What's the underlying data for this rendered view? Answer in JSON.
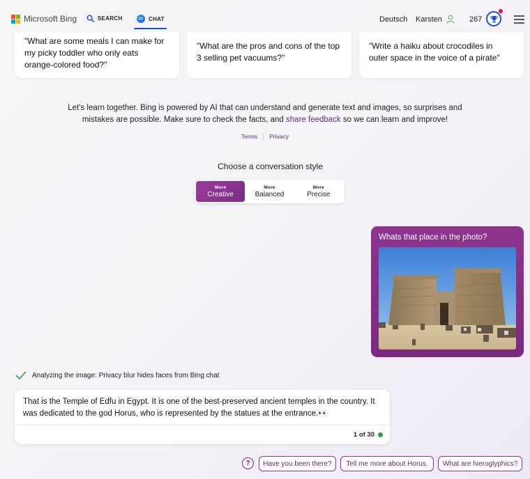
{
  "header": {
    "brand": "Microsoft Bing",
    "nav_search": "SEARCH",
    "nav_chat": "CHAT",
    "language": "Deutsch",
    "user_name": "Karsten",
    "points": "267"
  },
  "suggestions": [
    "\"What are some meals I can make for my picky toddler who only eats orange-colored food?\"",
    "\"What are the pros and cons of the top 3 selling pet vacuums?\"",
    "\"Write a haiku about crocodiles in outer space in the voice of a pirate\""
  ],
  "disclaimer": {
    "before": "Let's learn together. Bing is powered by AI that can understand and generate text and images, so surprises and mistakes are possible. Make sure to check the facts, and ",
    "link": "share feedback",
    "after": " so we can learn and improve!"
  },
  "links": {
    "terms": "Terms",
    "privacy": "Privacy"
  },
  "style_selector": {
    "title": "Choose a conversation style",
    "options": [
      {
        "small": "More",
        "big": "Creative",
        "active": true
      },
      {
        "small": "More",
        "big": "Balanced",
        "active": false
      },
      {
        "small": "More",
        "big": "Precise",
        "active": false
      }
    ]
  },
  "user_message": {
    "text": "Whats that place in the photo?"
  },
  "status": {
    "text": "Analyzing the image: Privacy blur hides faces from Bing chat"
  },
  "bot_message": {
    "text": "That is the Temple of Edfu in Egypt. It is one of the best-preserved ancient temples in the country. It was dedicated to the god Horus, who is represented by the statues at the entrance.👀",
    "counter": "1 of 30"
  },
  "suggested_replies": [
    "Have you been there?",
    "Tell me more about Horus.",
    "What are hieroglyphics?"
  ],
  "colors": {
    "accent_purple": "#7a2a7e",
    "link_purple": "#5c2d91",
    "nav_blue": "#174ae4",
    "notification_red": "#e81123",
    "status_green": "#2f9e44"
  }
}
